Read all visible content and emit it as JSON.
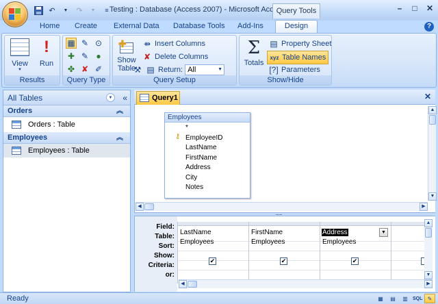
{
  "window": {
    "title": "Testing : Database (Access 2007) - Microsoft Acc...",
    "context_tab": "Query Tools"
  },
  "qat": {
    "save_icon": "save-icon",
    "undo_icon": "undo-icon",
    "redo_icon": "redo-icon",
    "customize_icon": "dropdown-icon"
  },
  "tabs": [
    "Home",
    "Create",
    "External Data",
    "Database Tools",
    "Add-Ins",
    "Design"
  ],
  "ribbon": {
    "results": {
      "label": "Results",
      "view": "View",
      "run": "Run"
    },
    "query_type": {
      "label": "Query Type"
    },
    "query_setup": {
      "label": "Query Setup",
      "show_table": "Show Table",
      "insert_columns": "Insert Columns",
      "delete_columns": "Delete Columns",
      "return_label": "Return:",
      "return_value": "All"
    },
    "show_hide": {
      "label": "Show/Hide",
      "totals": "Totals",
      "property_sheet": "Property Sheet",
      "table_names": "Table Names",
      "parameters": "Parameters"
    }
  },
  "nav": {
    "title": "All Tables",
    "groups": [
      {
        "name": "Orders",
        "items": [
          "Orders : Table"
        ]
      },
      {
        "name": "Employees",
        "items": [
          "Employees : Table"
        ]
      }
    ]
  },
  "document": {
    "tab": "Query1"
  },
  "field_list": {
    "title": "Employees",
    "fields": [
      "*",
      "EmployeeID",
      "LastName",
      "FirstName",
      "Address",
      "City",
      "Notes"
    ]
  },
  "grid": {
    "row_labels": [
      "Field:",
      "Table:",
      "Sort:",
      "Show:",
      "Criteria:",
      "or:"
    ],
    "columns": [
      {
        "field": "LastName",
        "table": "Employees",
        "show": "✔"
      },
      {
        "field": "FirstName",
        "table": "Employees",
        "show": "✔"
      },
      {
        "field": "Address",
        "table": "Employees",
        "show": "✔"
      }
    ]
  },
  "status": {
    "text": "Ready"
  }
}
